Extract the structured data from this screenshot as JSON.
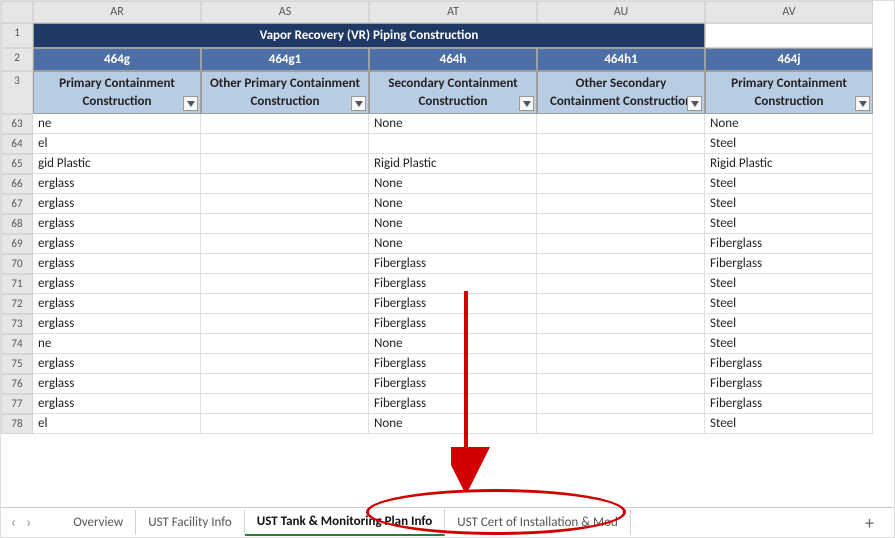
{
  "columns": [
    "AR",
    "AS",
    "AT",
    "AU",
    "AV"
  ],
  "row1": {
    "mergedTitle": "Vapor Recovery (VR) Piping Construction"
  },
  "row2": {
    "codes": [
      "464g",
      "464g1",
      "464h",
      "464h1",
      "464j"
    ]
  },
  "row3": {
    "names": [
      "Primary Containment Construction",
      "Other Primary Containment Construction",
      "Secondary Containment Construction",
      "Other Secondary Containment Construction",
      "Primary Containment Construction"
    ]
  },
  "rowNumbers": [
    "1",
    "2",
    "3",
    "63",
    "64",
    "65",
    "66",
    "67",
    "68",
    "69",
    "70",
    "71",
    "72",
    "73",
    "74",
    "75",
    "76",
    "77",
    "78"
  ],
  "dataRows": [
    {
      "r": "63",
      "c": [
        "ne",
        "",
        "None",
        "",
        "None"
      ]
    },
    {
      "r": "64",
      "c": [
        "el",
        "",
        "",
        "",
        "Steel"
      ]
    },
    {
      "r": "65",
      "c": [
        "gid Plastic",
        "",
        "Rigid Plastic",
        "",
        "Rigid Plastic"
      ]
    },
    {
      "r": "66",
      "c": [
        "erglass",
        "",
        "None",
        "",
        "Steel"
      ]
    },
    {
      "r": "67",
      "c": [
        "erglass",
        "",
        "None",
        "",
        "Steel"
      ]
    },
    {
      "r": "68",
      "c": [
        "erglass",
        "",
        "None",
        "",
        "Steel"
      ]
    },
    {
      "r": "69",
      "c": [
        "erglass",
        "",
        "None",
        "",
        "Fiberglass"
      ]
    },
    {
      "r": "70",
      "c": [
        "erglass",
        "",
        "Fiberglass",
        "",
        "Fiberglass"
      ]
    },
    {
      "r": "71",
      "c": [
        "erglass",
        "",
        "Fiberglass",
        "",
        "Steel"
      ]
    },
    {
      "r": "72",
      "c": [
        "erglass",
        "",
        "Fiberglass",
        "",
        "Steel"
      ]
    },
    {
      "r": "73",
      "c": [
        "erglass",
        "",
        "Fiberglass",
        "",
        "Steel"
      ]
    },
    {
      "r": "74",
      "c": [
        "ne",
        "",
        "None",
        "",
        "Steel"
      ]
    },
    {
      "r": "75",
      "c": [
        "erglass",
        "",
        "Fiberglass",
        "",
        "Fiberglass"
      ]
    },
    {
      "r": "76",
      "c": [
        "erglass",
        "",
        "Fiberglass",
        "",
        "Fiberglass"
      ]
    },
    {
      "r": "77",
      "c": [
        "erglass",
        "",
        "Fiberglass",
        "",
        "Fiberglass"
      ]
    },
    {
      "r": "78",
      "c": [
        "el",
        "",
        "None",
        "",
        "Steel"
      ]
    }
  ],
  "tabs": {
    "items": [
      "Overview",
      "UST Facility Info",
      "UST Tank & Monitoring Plan Info",
      "UST Cert of Installation & Mod"
    ],
    "activeIndex": 2
  },
  "glyphs": {
    "chevLeft": "‹",
    "chevRight": "›",
    "plus": "+"
  }
}
